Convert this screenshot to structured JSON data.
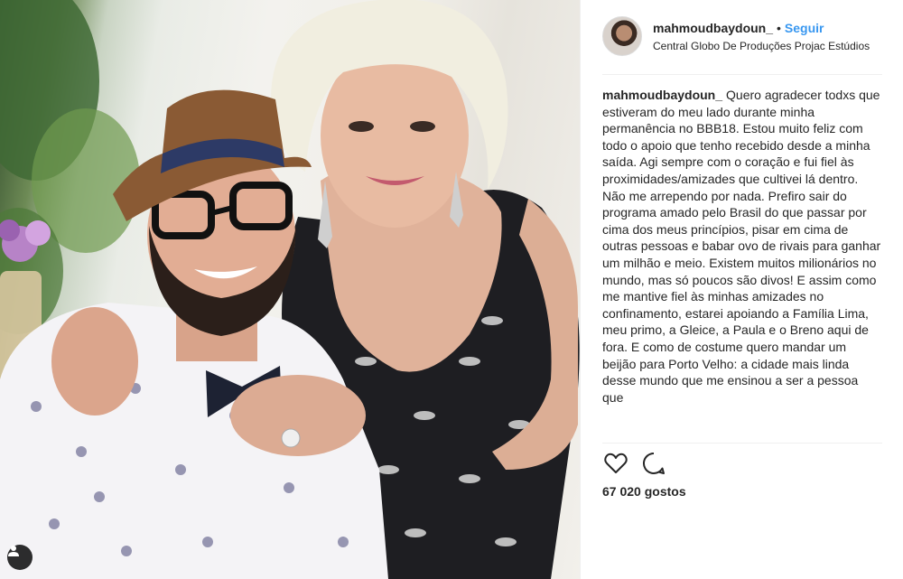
{
  "post": {
    "photo_alt_icon": "tagged-users-icon"
  },
  "header": {
    "username": "mahmoudbaydoun_",
    "separator": "•",
    "follow_label": "Seguir",
    "location": "Central Globo De Produções Projac Estúdios"
  },
  "caption": {
    "username": "mahmoudbaydoun_",
    "text": "Quero agradecer todxs que estiveram do meu lado durante minha permanência no BBB18. Estou muito feliz com todo o apoio que tenho recebido desde a minha saída. Agi sempre com o coração e fui fiel às proximidades/amizades que cultivei lá dentro. Não me arrependo por nada. Prefiro sair do programa amado pelo Brasil do que passar por cima dos meus princípios, pisar em cima de outras pessoas e babar ovo de rivais para ganhar um milhão e meio. Existem muitos milionários no mundo, mas só poucos são divos! E assim como me mantive fiel às minhas amizades no confinamento, estarei apoiando a Família Lima, meu primo, a Gleice, a Paula e o Breno aqui de fora. E como de costume quero mandar um beijão para Porto Velho: a cidade mais linda desse mundo que me ensinou a ser a pessoa que"
  },
  "actions": {
    "like_icon": "heart-icon",
    "comment_icon": "comment-icon"
  },
  "likes": {
    "text": "67 020 gostos"
  }
}
